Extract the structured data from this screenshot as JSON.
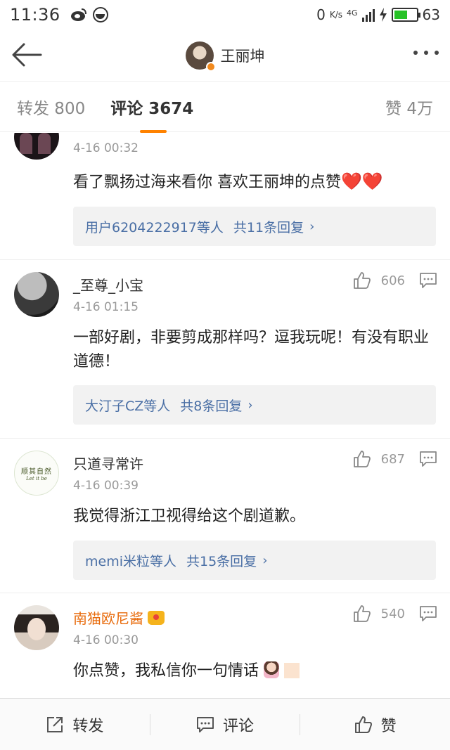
{
  "status_bar": {
    "time": "11:36",
    "network_speed_value": "0",
    "network_speed_unit": "K/s",
    "network_type": "4G",
    "battery": "63"
  },
  "header": {
    "title": "王丽坤"
  },
  "tabs": [
    {
      "label": "转发 800"
    },
    {
      "label": "评论 3674"
    },
    {
      "label": "赞 4万"
    }
  ],
  "comments": [
    {
      "time": "4-16 00:32",
      "text": "看了飘扬过海来看你 喜欢王丽坤的点赞",
      "emoji": "❤️❤️",
      "reply_users": "用户6204222917等人",
      "reply_count": "共11条回复"
    },
    {
      "username": "_至尊_小宝",
      "time": "4-16 01:15",
      "likes": "606",
      "text": "一部好剧，非要剪成那样吗？逗我玩呢！有没有职业道德！",
      "reply_users": "大汀子CZ等人",
      "reply_count": "共8条回复"
    },
    {
      "username": "只道寻常许",
      "avatar_text": "顺其自然",
      "avatar_subtext": "Let it be",
      "time": "4-16 00:39",
      "likes": "687",
      "text": "我觉得浙江卫视得给这个剧道歉。",
      "reply_users": "memi米粒等人",
      "reply_count": "共15条回复"
    },
    {
      "username": "南猫欧尼酱",
      "time": "4-16 00:30",
      "likes": "540",
      "text": "你点赞，我私信你一句情话"
    }
  ],
  "bottom_bar": {
    "repost": "转发",
    "comment": "评论",
    "like": "赞"
  },
  "colors": {
    "accent": "#ff8200",
    "link": "#4a6fa5",
    "vip_name": "#e86b0c"
  }
}
